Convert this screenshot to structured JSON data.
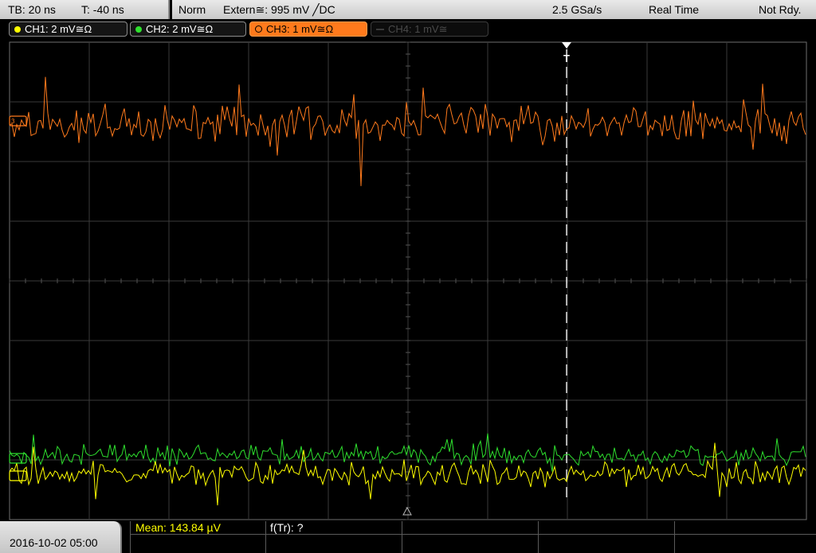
{
  "topbar": {
    "timebase": "TB: 20 ns",
    "trigger_time": "T: -40 ns",
    "mode": "Norm",
    "trigger_source": "Extern≅: 995 mV ╱DC",
    "sample_rate": "2.5 GSa/s",
    "acq_mode": "Real Time",
    "status": "Not Rdy."
  },
  "channels": [
    {
      "label": "CH1: 2 mV≅Ω",
      "color": "#ffff00",
      "state": "on"
    },
    {
      "label": "CH2: 2 mV≅Ω",
      "color": "#2ee02e",
      "state": "on"
    },
    {
      "label": "CH3: 1 mV≅Ω",
      "color": "#ff7a1c",
      "state": "active"
    },
    {
      "label": "CH4: 1 mV≅",
      "color": "#444444",
      "state": "off"
    }
  ],
  "trigger_marker": "T",
  "waveform_colors": {
    "ch1": "#ffff00",
    "ch2": "#2ee02e",
    "ch3": "#ff7a1c"
  },
  "bottombar": {
    "datetime": "2016-10-02 05:00",
    "mean_label": "Mean: 143.84 µV",
    "ftr_label": "f(Tr): ?"
  }
}
